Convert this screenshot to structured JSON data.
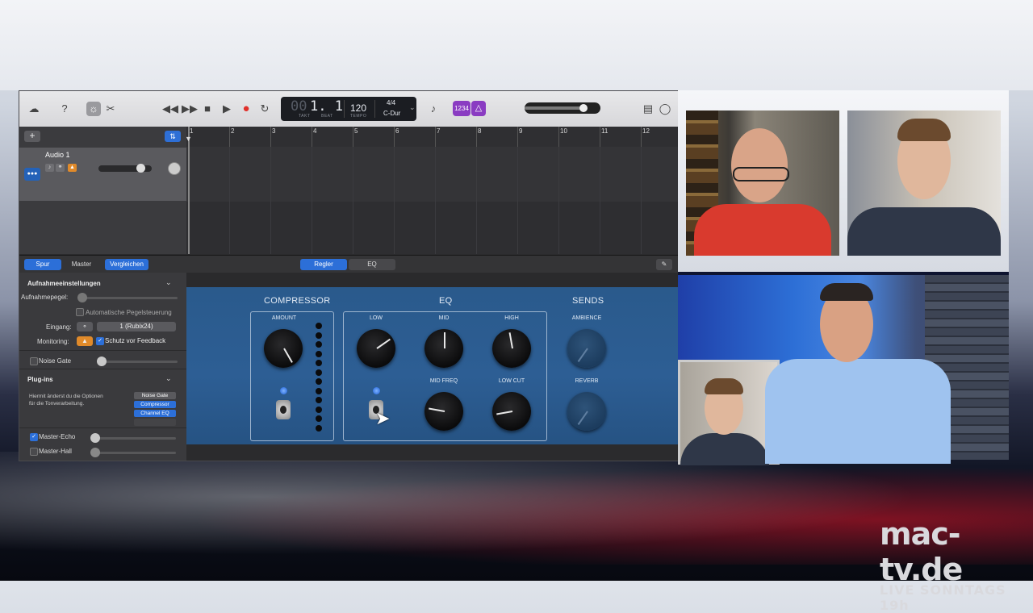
{
  "toolbar": {
    "lcd": {
      "bar": "00",
      "beat": "1. 1",
      "bar_label": "TAKT",
      "beat_label": "BEAT",
      "tempo": "120",
      "tempo_label": "TEMPO",
      "signature": "4/4",
      "key": "C-Dur"
    },
    "count_in": "1234",
    "master_volume": 0.78
  },
  "tracks": {
    "ruler_numbers": [
      "1",
      "2",
      "3",
      "4",
      "5",
      "6",
      "7",
      "8",
      "9",
      "10",
      "11",
      "12"
    ],
    "items": [
      {
        "name": "Audio 1",
        "volume": 0.8
      }
    ]
  },
  "smart_controls": {
    "left_tabs": [
      "Spur",
      "Master",
      "Vergleichen"
    ],
    "right_tabs": [
      "Regler",
      "EQ"
    ],
    "active_left": "Spur",
    "active_right": "Regler"
  },
  "inspector": {
    "recording_title": "Aufnahmeeinstellungen",
    "input_level_label": "Aufnahmepegel:",
    "auto_level_label": "Automatische Pegelsteuerung",
    "input_label": "Eingang:",
    "input_value": "1 (Rubix24)",
    "monitoring_label": "Monitoring:",
    "feedback_label": "Schutz vor Feedback",
    "noise_gate_label": "Noise Gate",
    "plugins_title": "Plug-ins",
    "plugins_desc": "Hiermit änderst du die Optionen für die Tonverarbeitung.",
    "plugins": [
      "Noise Gate",
      "Compressor",
      "Channel EQ"
    ],
    "master_echo_label": "Master-Echo",
    "master_hall_label": "Master-Hall"
  },
  "controls": {
    "compressor_title": "COMPRESSOR",
    "eq_title": "EQ",
    "sends_title": "SENDS",
    "amount_label": "AMOUNT",
    "low_label": "LOW",
    "mid_label": "MID",
    "high_label": "HIGH",
    "mid_freq_label": "MID FREQ",
    "low_cut_label": "LOW CUT",
    "ambience_label": "AMBIENCE",
    "reverb_label": "REVERB"
  },
  "brand": {
    "name": "mac-tv.de",
    "tagline": "LIVE SONNTAGS 19h"
  },
  "colors": {
    "accent": "#2c6fd8",
    "record": "#e0302a",
    "purple": "#8a3cc2",
    "orange": "#e08a2a"
  }
}
